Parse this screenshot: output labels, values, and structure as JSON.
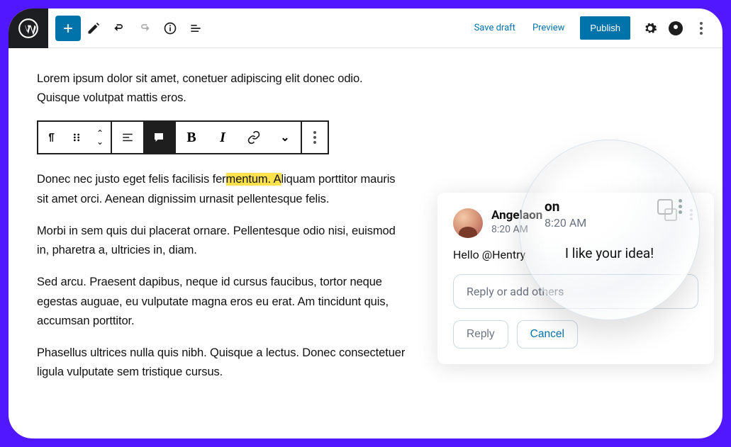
{
  "topbar": {
    "save_draft": "Save draft",
    "preview": "Preview",
    "publish": "Publish"
  },
  "para1": "Lorem ipsum dolor sit amet, conetuer adipiscing elit donec odio. Quisque volutpat mattis eros.",
  "toolbar": {
    "bold": "B",
    "italic": "I"
  },
  "para2a": "Donec nec justo eget felis facilisis fer",
  "para2_hl": "mentum. A",
  "para2b": "liquam porttitor mauris sit amet orci. Aenean dignissim urnasit pellentesque felis.",
  "para3": "Morbi in sem quis dui placerat ornare. Pellentesque odio nisi, euismod in, pharetra a, ultricies in, diam.",
  "para4": "Sed arcu. Praesent dapibus, neque id cursus faucibus, tortor neque egestas auguae, eu vulputate magna eros eu erat. Am tincidunt quis, accumsan porttitor.",
  "para5": "Phasellus ultrices nulla quis nibh. Quisque a lectus. Donec consectetuer ligula vulputate sem tristique cursus.",
  "comment": {
    "author": "Angela",
    "author_zoom_suffix": "on",
    "time": "8:20 AM",
    "body": "Hello @Hentry",
    "reply_placeholder": "Reply or add others",
    "reply_btn": "Reply",
    "cancel_btn": "Cancel"
  },
  "bubble": {
    "name_suffix": "on",
    "time": "8:20 AM",
    "text": "I like your idea!"
  }
}
